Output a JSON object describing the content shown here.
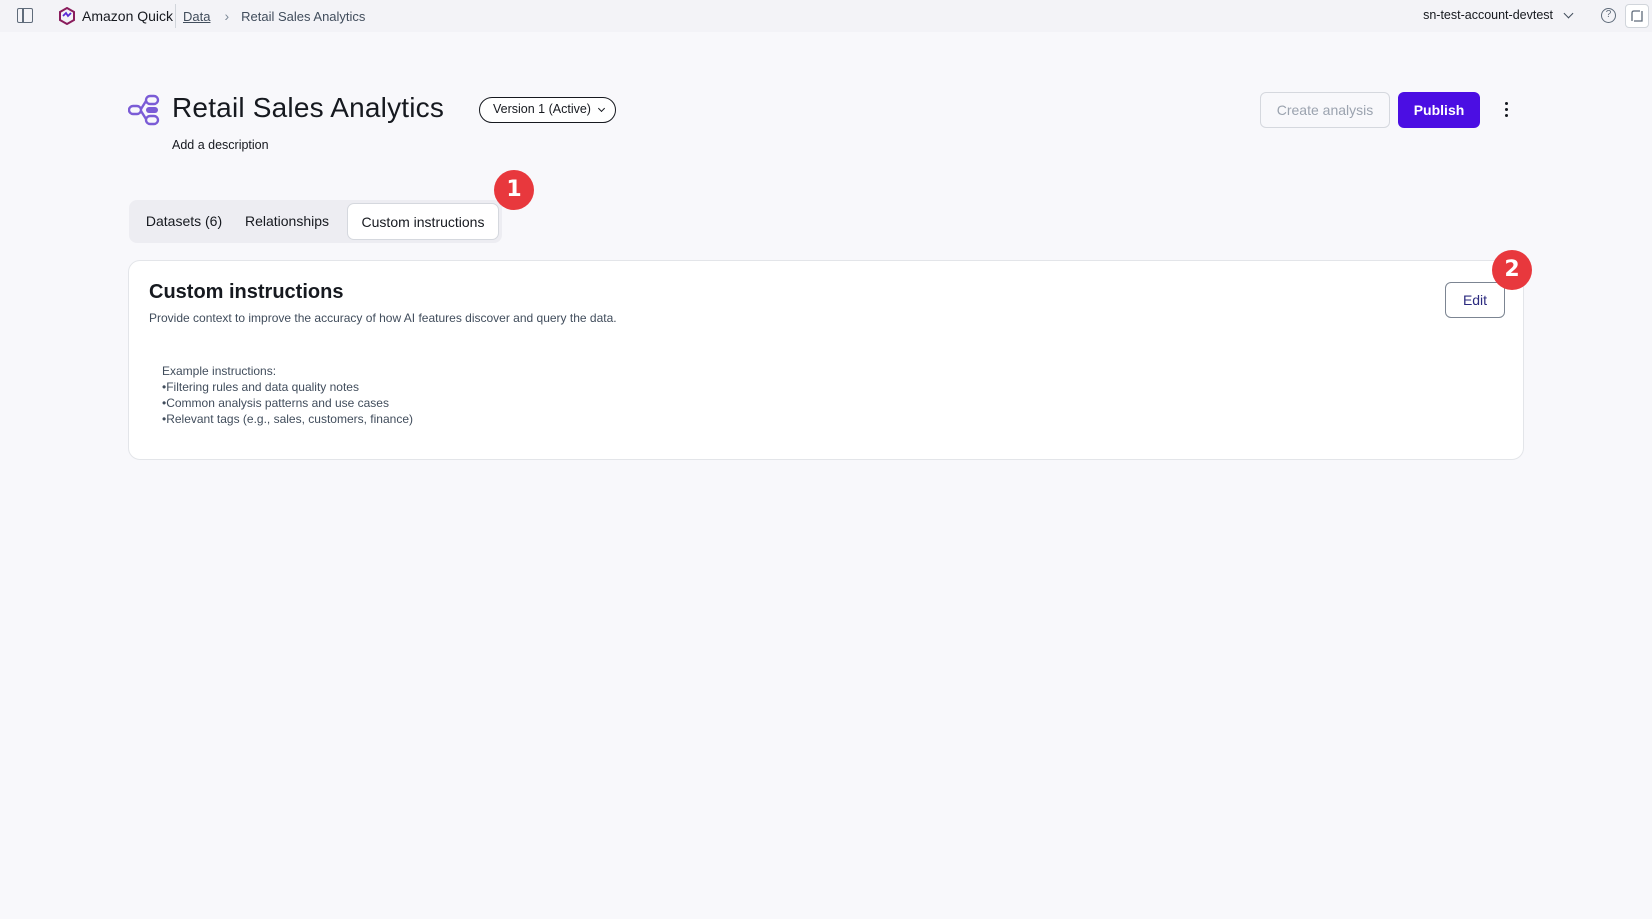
{
  "app": {
    "name": "Amazon Quick",
    "account": "sn-test-account-devtest"
  },
  "breadcrumb": {
    "root": "Data",
    "current": "Retail Sales Analytics"
  },
  "header": {
    "title": "Retail Sales Analytics",
    "add_description": "Add a description",
    "version": "Version 1 (Active)",
    "create_analysis_label": "Create analysis",
    "publish_label": "Publish"
  },
  "tabs": [
    {
      "label": "Datasets (6)",
      "selected": false
    },
    {
      "label": "Relationships",
      "selected": false
    },
    {
      "label": "Custom instructions",
      "selected": true
    }
  ],
  "markers": [
    "1",
    "2"
  ],
  "card": {
    "title": "Custom instructions",
    "subtitle": "Provide context to improve the accuracy of how AI features discover and query the data.",
    "edit_label": "Edit",
    "example_heading": "Example instructions:",
    "example_items": [
      "Filtering rules and data quality notes",
      "Common analysis patterns and use cases",
      "Relevant tags (e.g., sales, customers, finance)"
    ]
  },
  "colors": {
    "accent": "#4b0ee3",
    "marker": "#e8383d",
    "dataset_icon": "#7b5cd6",
    "page_bg": "#f8f8fb"
  },
  "icons": {
    "sidebar": "sidebar-toggle-icon",
    "logo": "amazon-quick-logo-icon",
    "help": "help-icon",
    "dataset": "dataset-relationship-icon",
    "more": "more-vertical-icon"
  }
}
